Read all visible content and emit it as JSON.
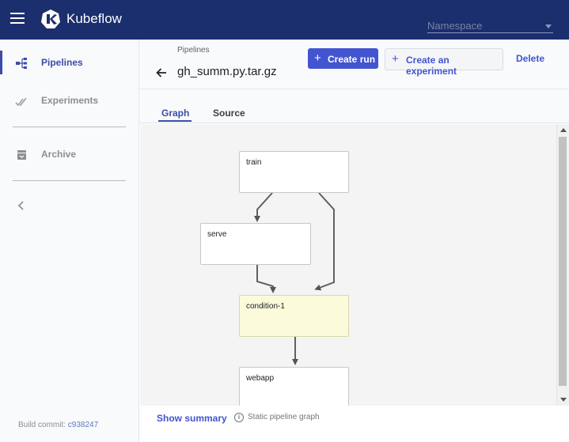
{
  "app": {
    "brand": "Kubeflow",
    "namespace_placeholder": "Namespace"
  },
  "sidebar": {
    "items": [
      {
        "label": "Pipelines",
        "icon": "pipelines-icon",
        "active": true
      },
      {
        "label": "Experiments",
        "icon": "experiments-icon",
        "active": false
      },
      {
        "label": "Archive",
        "icon": "archive-icon",
        "active": false
      }
    ],
    "build_commit_label": "Build commit:",
    "build_commit_hash": "c938247"
  },
  "header": {
    "breadcrumb": "Pipelines",
    "title": "gh_summ.py.tar.gz",
    "create_run_label": "Create run",
    "create_experiment_label": "Create an experiment",
    "delete_label": "Delete"
  },
  "tabs": [
    {
      "label": "Graph",
      "active": true
    },
    {
      "label": "Source",
      "active": false
    }
  ],
  "graph": {
    "nodes": [
      {
        "id": "train",
        "label": "train"
      },
      {
        "id": "serve",
        "label": "serve"
      },
      {
        "id": "condition-1",
        "label": "condition-1"
      },
      {
        "id": "webapp",
        "label": "webapp"
      }
    ],
    "edges": [
      [
        "train",
        "serve"
      ],
      [
        "train",
        "condition-1"
      ],
      [
        "serve",
        "condition-1"
      ],
      [
        "condition-1",
        "webapp"
      ]
    ]
  },
  "footer": {
    "show_summary_label": "Show summary",
    "static_note": "Static pipeline graph"
  },
  "colors": {
    "topbar": "#1b2e6e",
    "accent": "#4354d0",
    "condition_node": "#fbfbdb"
  }
}
